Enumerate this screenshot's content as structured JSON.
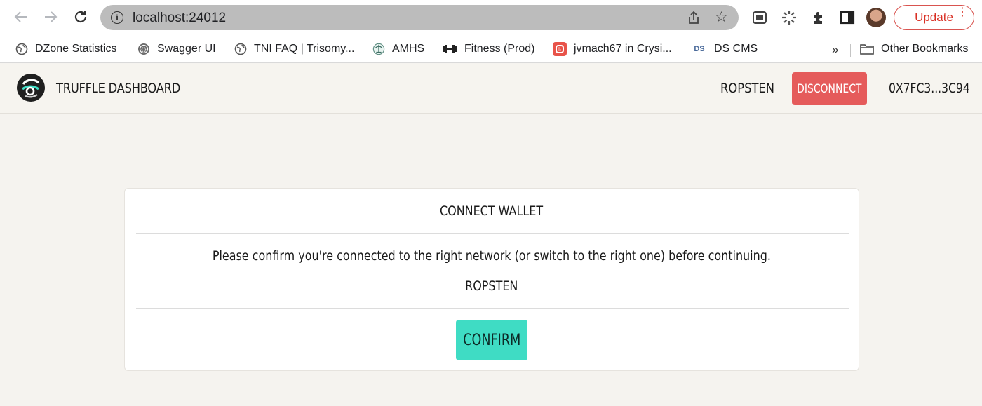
{
  "browser": {
    "url": "localhost:24012",
    "update_label": "Update",
    "bookmarks": [
      {
        "label": "DZone Statistics",
        "icon": "globe-icon"
      },
      {
        "label": "Swagger UI",
        "icon": "swagger-icon"
      },
      {
        "label": "TNI FAQ | Trisomy...",
        "icon": "globe-icon"
      },
      {
        "label": "AMHS",
        "icon": "amhs-icon"
      },
      {
        "label": "Fitness (Prod)",
        "icon": "dumbbell-icon"
      },
      {
        "label": "jvmach67 in Crysi...",
        "icon": "blogger-icon"
      },
      {
        "label": "DS CMS",
        "icon": "ds-icon"
      }
    ],
    "more_label": "»",
    "other_bookmarks_label": "Other Bookmarks"
  },
  "app": {
    "title": "TRUFFLE DASHBOARD",
    "network": "ROPSTEN",
    "disconnect_label": "DISCONNECT",
    "address": "0X7FC3...3C94"
  },
  "card": {
    "title": "CONNECT WALLET",
    "message": "Please confirm you're connected to the right network (or switch to the right one) before continuing.",
    "network": "ROPSTEN",
    "confirm_label": "CONFIRM"
  },
  "colors": {
    "disconnect": "#e55b5b",
    "confirm": "#3fdcc4",
    "page_bg": "#f5f3ef"
  }
}
